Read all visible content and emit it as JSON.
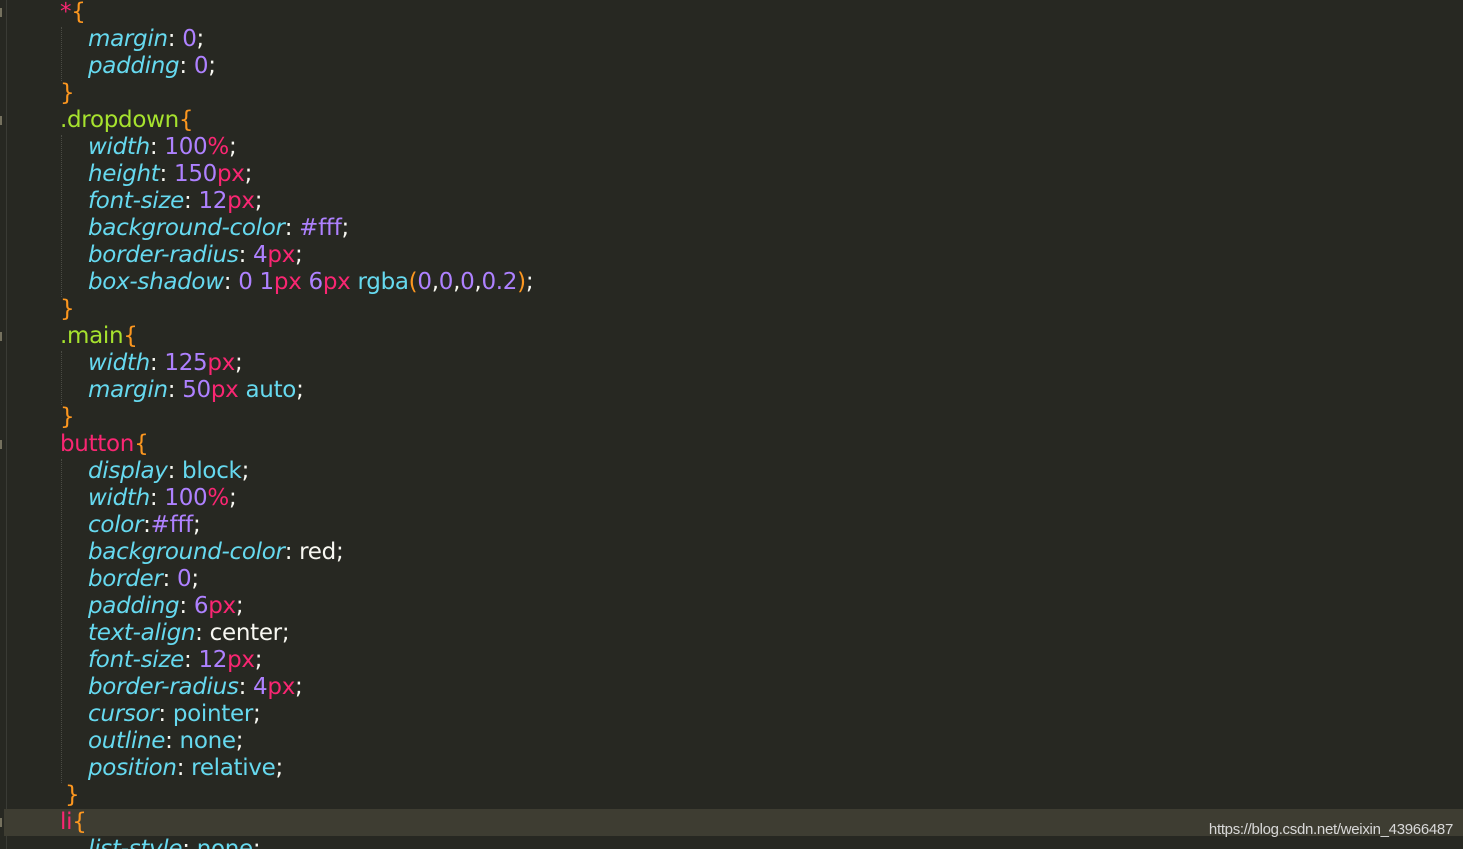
{
  "editor": {
    "colors": {
      "background": "#272822",
      "current_line": "#3e3d32",
      "property": "#66d9ef",
      "number": "#ae81ff",
      "unit": "#f92672",
      "brace": "#fd971f",
      "class_selector": "#a6e22e",
      "tag_selector": "#f92672",
      "text": "#f8f8f2"
    },
    "lines": [
      [
        {
          "t": "*",
          "c": "sel-tag"
        },
        {
          "t": "{",
          "c": "brace"
        }
      ],
      [
        {
          "t": "margin",
          "c": "prop"
        },
        {
          "t": ": ",
          "c": "punc"
        },
        {
          "t": "0",
          "c": "num"
        },
        {
          "t": ";",
          "c": "punc"
        }
      ],
      [
        {
          "t": "padding",
          "c": "prop"
        },
        {
          "t": ": ",
          "c": "punc"
        },
        {
          "t": "0",
          "c": "num"
        },
        {
          "t": ";",
          "c": "punc"
        }
      ],
      [
        {
          "t": "}",
          "c": "brace"
        }
      ],
      [
        {
          "t": ".dropdown",
          "c": "sel-class"
        },
        {
          "t": "{",
          "c": "brace"
        }
      ],
      [
        {
          "t": "width",
          "c": "prop"
        },
        {
          "t": ": ",
          "c": "punc"
        },
        {
          "t": "100",
          "c": "num"
        },
        {
          "t": "%",
          "c": "unit"
        },
        {
          "t": ";",
          "c": "punc"
        }
      ],
      [
        {
          "t": "height",
          "c": "prop"
        },
        {
          "t": ": ",
          "c": "punc"
        },
        {
          "t": "150",
          "c": "num"
        },
        {
          "t": "px",
          "c": "unit"
        },
        {
          "t": ";",
          "c": "punc"
        }
      ],
      [
        {
          "t": "font-size",
          "c": "prop"
        },
        {
          "t": ": ",
          "c": "punc"
        },
        {
          "t": "12",
          "c": "num"
        },
        {
          "t": "px",
          "c": "unit"
        },
        {
          "t": ";",
          "c": "punc"
        }
      ],
      [
        {
          "t": "background-color",
          "c": "prop"
        },
        {
          "t": ": ",
          "c": "punc"
        },
        {
          "t": "#fff",
          "c": "num"
        },
        {
          "t": ";",
          "c": "punc"
        }
      ],
      [
        {
          "t": "border-radius",
          "c": "prop"
        },
        {
          "t": ": ",
          "c": "punc"
        },
        {
          "t": "4",
          "c": "num"
        },
        {
          "t": "px",
          "c": "unit"
        },
        {
          "t": ";",
          "c": "punc"
        }
      ],
      [
        {
          "t": "box-shadow",
          "c": "prop"
        },
        {
          "t": ": ",
          "c": "punc"
        },
        {
          "t": "0 1",
          "c": "num"
        },
        {
          "t": "px",
          "c": "unit"
        },
        {
          "t": " ",
          "c": "punc"
        },
        {
          "t": "6",
          "c": "num"
        },
        {
          "t": "px",
          "c": "unit"
        },
        {
          "t": " ",
          "c": "punc"
        },
        {
          "t": "rgba",
          "c": "fn"
        },
        {
          "t": "(",
          "c": "brace"
        },
        {
          "t": "0",
          "c": "num"
        },
        {
          "t": ",",
          "c": "punc"
        },
        {
          "t": "0",
          "c": "num"
        },
        {
          "t": ",",
          "c": "punc"
        },
        {
          "t": "0",
          "c": "num"
        },
        {
          "t": ",",
          "c": "punc"
        },
        {
          "t": "0.2",
          "c": "num"
        },
        {
          "t": ")",
          "c": "brace"
        },
        {
          "t": ";",
          "c": "punc"
        }
      ],
      [
        {
          "t": "}",
          "c": "brace"
        }
      ],
      [
        {
          "t": ".main",
          "c": "sel-class"
        },
        {
          "t": "{",
          "c": "brace"
        }
      ],
      [
        {
          "t": "width",
          "c": "prop"
        },
        {
          "t": ": ",
          "c": "punc"
        },
        {
          "t": "125",
          "c": "num"
        },
        {
          "t": "px",
          "c": "unit"
        },
        {
          "t": ";",
          "c": "punc"
        }
      ],
      [
        {
          "t": "margin",
          "c": "prop"
        },
        {
          "t": ": ",
          "c": "punc"
        },
        {
          "t": "50",
          "c": "num"
        },
        {
          "t": "px",
          "c": "unit"
        },
        {
          "t": " ",
          "c": "punc"
        },
        {
          "t": "auto",
          "c": "kw"
        },
        {
          "t": ";",
          "c": "punc"
        }
      ],
      [
        {
          "t": "}",
          "c": "brace"
        }
      ],
      [
        {
          "t": "button",
          "c": "sel-tag"
        },
        {
          "t": "{",
          "c": "brace"
        }
      ],
      [
        {
          "t": "display",
          "c": "prop"
        },
        {
          "t": ": ",
          "c": "punc"
        },
        {
          "t": "block",
          "c": "kw"
        },
        {
          "t": ";",
          "c": "punc"
        }
      ],
      [
        {
          "t": "width",
          "c": "prop"
        },
        {
          "t": ": ",
          "c": "punc"
        },
        {
          "t": "100",
          "c": "num"
        },
        {
          "t": "%",
          "c": "unit"
        },
        {
          "t": ";",
          "c": "punc"
        }
      ],
      [
        {
          "t": "color",
          "c": "prop"
        },
        {
          "t": ":",
          "c": "punc"
        },
        {
          "t": "#fff",
          "c": "num"
        },
        {
          "t": ";",
          "c": "punc"
        }
      ],
      [
        {
          "t": "background-color",
          "c": "prop"
        },
        {
          "t": ": ",
          "c": "punc"
        },
        {
          "t": "red",
          "c": "plain"
        },
        {
          "t": ";",
          "c": "punc"
        }
      ],
      [
        {
          "t": "border",
          "c": "prop"
        },
        {
          "t": ": ",
          "c": "punc"
        },
        {
          "t": "0",
          "c": "num"
        },
        {
          "t": ";",
          "c": "punc"
        }
      ],
      [
        {
          "t": "padding",
          "c": "prop"
        },
        {
          "t": ": ",
          "c": "punc"
        },
        {
          "t": "6",
          "c": "num"
        },
        {
          "t": "px",
          "c": "unit"
        },
        {
          "t": ";",
          "c": "punc"
        }
      ],
      [
        {
          "t": "text-align",
          "c": "prop"
        },
        {
          "t": ": ",
          "c": "punc"
        },
        {
          "t": "center",
          "c": "plain"
        },
        {
          "t": ";",
          "c": "punc"
        }
      ],
      [
        {
          "t": "font-size",
          "c": "prop"
        },
        {
          "t": ": ",
          "c": "punc"
        },
        {
          "t": "12",
          "c": "num"
        },
        {
          "t": "px",
          "c": "unit"
        },
        {
          "t": ";",
          "c": "punc"
        }
      ],
      [
        {
          "t": "border-radius",
          "c": "prop"
        },
        {
          "t": ": ",
          "c": "punc"
        },
        {
          "t": "4",
          "c": "num"
        },
        {
          "t": "px",
          "c": "unit"
        },
        {
          "t": ";",
          "c": "punc"
        }
      ],
      [
        {
          "t": "cursor",
          "c": "prop"
        },
        {
          "t": ": ",
          "c": "punc"
        },
        {
          "t": "pointer",
          "c": "kw"
        },
        {
          "t": ";",
          "c": "punc"
        }
      ],
      [
        {
          "t": "outline",
          "c": "prop"
        },
        {
          "t": ": ",
          "c": "punc"
        },
        {
          "t": "none",
          "c": "kw"
        },
        {
          "t": ";",
          "c": "punc"
        }
      ],
      [
        {
          "t": "position",
          "c": "prop"
        },
        {
          "t": ": ",
          "c": "punc"
        },
        {
          "t": "relative",
          "c": "kw"
        },
        {
          "t": ";",
          "c": "punc"
        }
      ],
      [
        {
          "t": "}",
          "c": "brace"
        }
      ],
      [
        {
          "t": "li",
          "c": "sel-tag"
        },
        {
          "t": "{",
          "c": "brace"
        }
      ],
      [
        {
          "t": "list-style",
          "c": "prop"
        },
        {
          "t": ": ",
          "c": "punc"
        },
        {
          "t": "none",
          "c": "kw"
        },
        {
          "t": ";",
          "c": "punc"
        }
      ]
    ],
    "current_line_index": 30
  },
  "watermark": "https://blog.csdn.net/weixin_43966487"
}
